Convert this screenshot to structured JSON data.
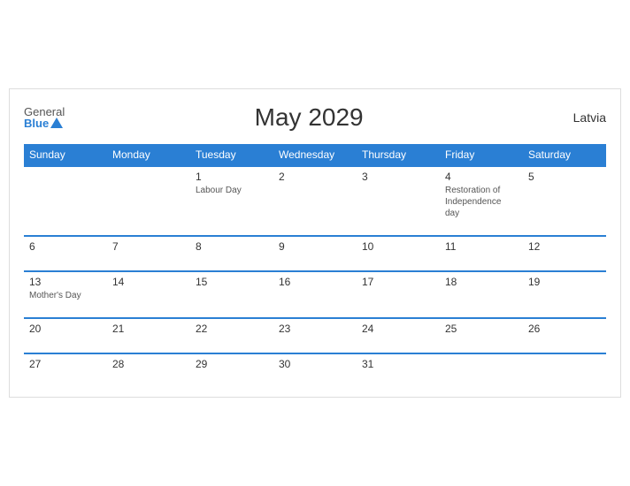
{
  "header": {
    "logo_general": "General",
    "logo_blue": "Blue",
    "title": "May 2029",
    "country": "Latvia"
  },
  "weekdays": [
    "Sunday",
    "Monday",
    "Tuesday",
    "Wednesday",
    "Thursday",
    "Friday",
    "Saturday"
  ],
  "weeks": [
    [
      {
        "day": "",
        "event": ""
      },
      {
        "day": "",
        "event": ""
      },
      {
        "day": "1",
        "event": "Labour Day"
      },
      {
        "day": "2",
        "event": ""
      },
      {
        "day": "3",
        "event": ""
      },
      {
        "day": "4",
        "event": "Restoration of Independence day"
      },
      {
        "day": "5",
        "event": ""
      }
    ],
    [
      {
        "day": "6",
        "event": ""
      },
      {
        "day": "7",
        "event": ""
      },
      {
        "day": "8",
        "event": ""
      },
      {
        "day": "9",
        "event": ""
      },
      {
        "day": "10",
        "event": ""
      },
      {
        "day": "11",
        "event": ""
      },
      {
        "day": "12",
        "event": ""
      }
    ],
    [
      {
        "day": "13",
        "event": "Mother's Day"
      },
      {
        "day": "14",
        "event": ""
      },
      {
        "day": "15",
        "event": ""
      },
      {
        "day": "16",
        "event": ""
      },
      {
        "day": "17",
        "event": ""
      },
      {
        "day": "18",
        "event": ""
      },
      {
        "day": "19",
        "event": ""
      }
    ],
    [
      {
        "day": "20",
        "event": ""
      },
      {
        "day": "21",
        "event": ""
      },
      {
        "day": "22",
        "event": ""
      },
      {
        "day": "23",
        "event": ""
      },
      {
        "day": "24",
        "event": ""
      },
      {
        "day": "25",
        "event": ""
      },
      {
        "day": "26",
        "event": ""
      }
    ],
    [
      {
        "day": "27",
        "event": ""
      },
      {
        "day": "28",
        "event": ""
      },
      {
        "day": "29",
        "event": ""
      },
      {
        "day": "30",
        "event": ""
      },
      {
        "day": "31",
        "event": ""
      },
      {
        "day": "",
        "event": ""
      },
      {
        "day": "",
        "event": ""
      }
    ]
  ]
}
